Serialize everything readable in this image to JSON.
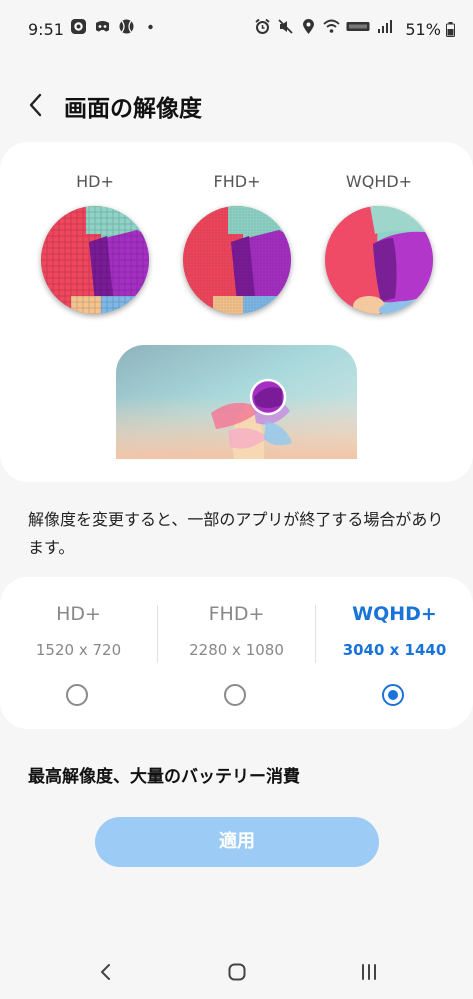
{
  "status_bar": {
    "time": "9:51",
    "battery": "51%",
    "left_icons": [
      "messenger-icon",
      "discord-icon",
      "sports-ball-icon",
      "dot-icon"
    ],
    "right_icons": [
      "alarm-icon",
      "mute-icon",
      "location-icon",
      "wifi-icon",
      "volte-icon",
      "signal-icon",
      "battery-icon"
    ]
  },
  "header": {
    "title": "画面の解像度"
  },
  "preview": {
    "labels": [
      "HD+",
      "FHD+",
      "WQHD+"
    ]
  },
  "notice": "解像度を変更すると、一部のアプリが終了する場合があります。",
  "options": [
    {
      "name": "HD+",
      "dims": "1520 x 720",
      "selected": false
    },
    {
      "name": "FHD+",
      "dims": "2280 x 1080",
      "selected": false
    },
    {
      "name": "WQHD+",
      "dims": "3040 x 1440",
      "selected": true
    }
  ],
  "warning": "最高解像度、大量のバッテリー消費",
  "apply_label": "適用",
  "colors": {
    "accent": "#1a73d9",
    "apply_button": "#9ccbf5",
    "background": "#f6f6f6"
  }
}
